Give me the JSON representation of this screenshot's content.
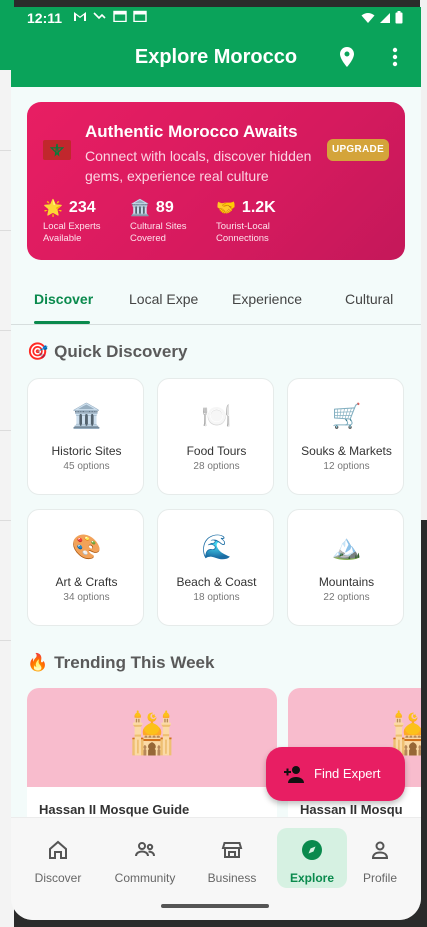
{
  "status": {
    "time": "12:11"
  },
  "appbar": {
    "title": "Explore Morocco"
  },
  "hero": {
    "title": "Authentic Morocco Awaits",
    "subtitle": "Connect with locals, discover hidden gems, experience real culture",
    "upgrade": "UPGRADE",
    "stats": [
      {
        "emoji": "🌟",
        "value": "234",
        "label_line1": "Local Experts",
        "label_line2": "Available"
      },
      {
        "emoji": "🏛️",
        "value": "89",
        "label_line1": "Cultural Sites",
        "label_line2": "Covered"
      },
      {
        "emoji": "🤝",
        "value": "1.2K",
        "label_line1": "Tourist-Local",
        "label_line2": "Connections"
      }
    ]
  },
  "tabs": [
    "Discover",
    "Local Expe",
    "Experience",
    "Cultural"
  ],
  "quick": {
    "emoji": "🎯",
    "title": "Quick Discovery",
    "items": [
      {
        "emoji": "🏛️",
        "name": "Historic Sites",
        "count": "45 options"
      },
      {
        "emoji": "🍽️",
        "name": "Food Tours",
        "count": "28 options"
      },
      {
        "emoji": "🛒",
        "name": "Souks & Markets",
        "count": "12 options"
      },
      {
        "emoji": "🎨",
        "name": "Art & Crafts",
        "count": "34 options"
      },
      {
        "emoji": "🌊",
        "name": "Beach & Coast",
        "count": "18 options"
      },
      {
        "emoji": "🏔️",
        "name": "Mountains",
        "count": "22 options"
      }
    ]
  },
  "trending": {
    "emoji": "🔥",
    "title": "Trending This Week",
    "items": [
      {
        "emoji": "🕌",
        "name": "Hassan II Mosque Guide"
      },
      {
        "emoji": "🕌",
        "name": "Hassan II Mosqu"
      }
    ]
  },
  "fab": {
    "label": "Find Expert"
  },
  "nav": [
    "Discover",
    "Community",
    "Business",
    "Explore",
    "Profile"
  ],
  "colors": {
    "primary": "#0aa35a",
    "accent": "#e81e63",
    "gold": "#d4a43a"
  },
  "icons": [
    "location-pin-icon",
    "more-vert-icon",
    "person-add-icon",
    "home-icon",
    "group-icon",
    "store-icon",
    "compass-icon",
    "person-icon"
  ]
}
